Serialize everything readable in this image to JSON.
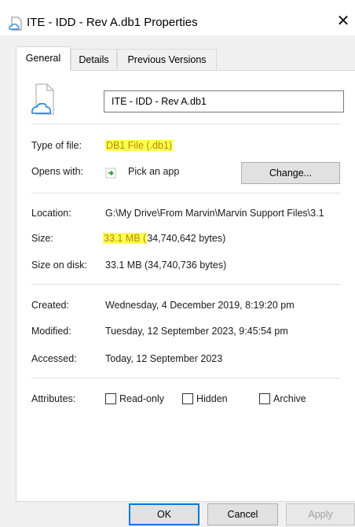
{
  "window": {
    "title": "ITE - IDD - Rev A.db1 Properties",
    "close_glyph": "✕"
  },
  "tabs": [
    {
      "label": "General",
      "active": true
    },
    {
      "label": "Details",
      "active": false
    },
    {
      "label": "Previous Versions",
      "active": false
    }
  ],
  "general": {
    "file_name": "ITE - IDD - Rev A.db1",
    "type_of_file": {
      "label": "Type of file:",
      "value": "DB1 File (.db1)"
    },
    "opens_with": {
      "label": "Opens with:",
      "value": "Pick an app",
      "change_button": "Change..."
    },
    "location": {
      "label": "Location:",
      "value": "G:\\My Drive\\From Marvin\\Marvin Support Files\\3.1"
    },
    "size": {
      "label": "Size:",
      "value_highlight": "33.1 MB (",
      "value_rest": "34,740,642 bytes)"
    },
    "size_on_disk": {
      "label": "Size on disk:",
      "value": "33.1 MB (34,740,736 bytes)"
    },
    "created": {
      "label": "Created:",
      "value": "Wednesday, 4 December 2019, 8:19:20 pm"
    },
    "modified": {
      "label": "Modified:",
      "value": "Tuesday, 12 September 2023, 9:45:54 pm"
    },
    "accessed": {
      "label": "Accessed:",
      "value": "Today, 12 September 2023"
    },
    "attributes": {
      "label": "Attributes:",
      "read_only": {
        "label": "Read-only",
        "checked": false
      },
      "hidden": {
        "label": "Hidden",
        "checked": false
      },
      "archive": {
        "label": "Archive",
        "checked": false
      }
    }
  },
  "buttons": {
    "ok": "OK",
    "cancel": "Cancel",
    "apply": "Apply"
  },
  "colors": {
    "highlight": "#ffff4f",
    "highlight_text": "#b8860b",
    "default_button_border": "#0078d7",
    "cloud_icon": "#1e7fd8"
  },
  "icons": [
    "cloud-file-icon",
    "close-icon",
    "pick-app-arrow-icon"
  ]
}
